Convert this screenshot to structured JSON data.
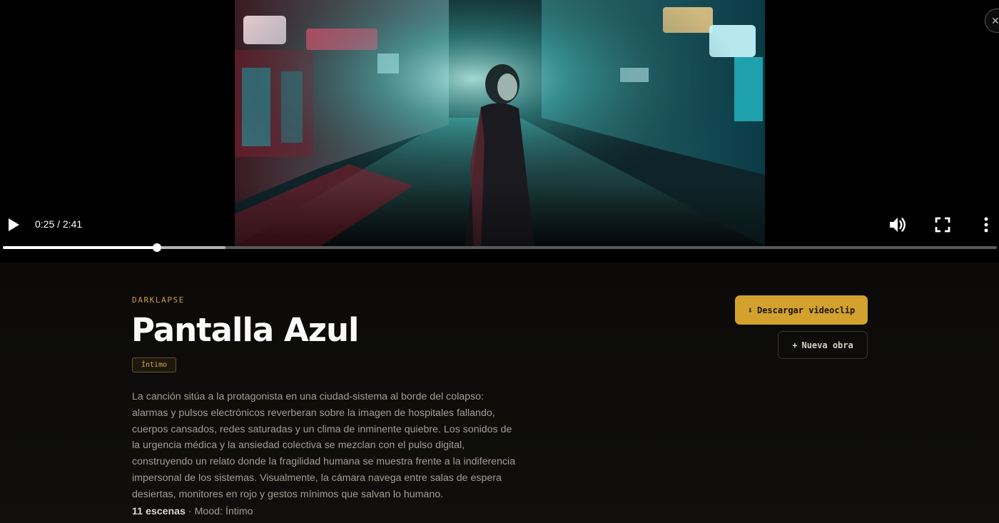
{
  "player": {
    "current_time": "0:25",
    "duration": "2:41",
    "time_display": "0:25 / 2:41",
    "progress_fraction": 0.1553,
    "buffered_fraction": 0.224,
    "frame_description_icon": "video-frame",
    "icons": {
      "play": "play-icon",
      "volume": "volume-icon",
      "fullscreen": "fullscreen-icon",
      "more": "more-vert-icon",
      "close": "close-icon"
    },
    "close_glyph": "✕"
  },
  "work": {
    "artist": "DARKLAPSE",
    "title": "Pantalla Azul",
    "mood_badge": "Íntimo",
    "description": "La canción sitúa a la protagonista en una ciudad-sistema al borde del colapso: alarmas y pulsos electrónicos reverberan sobre la imagen de hospitales fallando, cuerpos cansados, redes saturadas y un clima de inminente quiebre. Los sonidos de la urgencia médica y la ansiedad colectiva se mezclan con el pulso digital, construyendo un relato donde la fragilidad humana se muestra frente a la indiferencia impersonal de los sistemas. Visualmente, la cámara navega entre salas de espera desiertas, monitores en rojo y gestos mínimos que salvan lo humano.",
    "scenes": "11 escenas",
    "meta_separator": " · ",
    "mood_text": "Mood: Íntimo"
  },
  "actions": {
    "download_icon": "⬇",
    "download_label": "Descargar videoclip",
    "new_icon": "+",
    "new_label": "Nueva obra"
  },
  "colors": {
    "accent": "#d3a12e",
    "badge_text": "#d8aa4c",
    "background": "#0e0d0b"
  }
}
